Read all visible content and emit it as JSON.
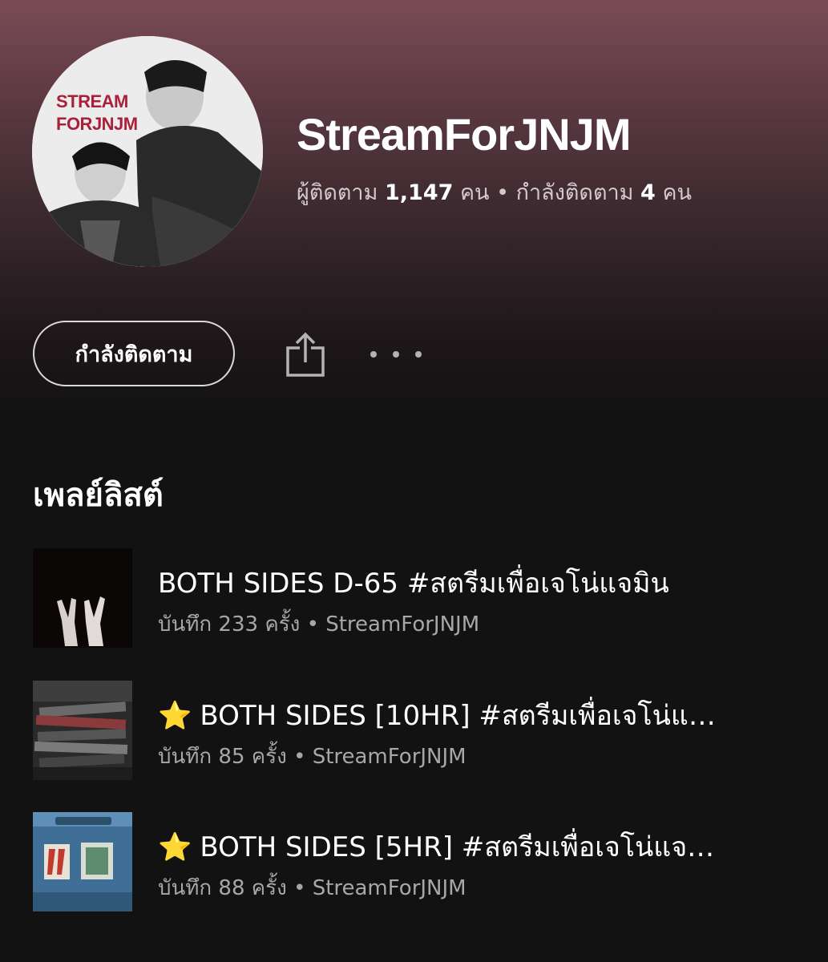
{
  "profile": {
    "avatar_text_line1": "STREAM",
    "avatar_text_line2": "FORJNJM",
    "name": "StreamForJNJM",
    "followers_label": "ผู้ติดตาม",
    "followers_count": "1,147",
    "followers_unit": "คน",
    "separator": "•",
    "following_label": "กำลังติดตาม",
    "following_count": "4",
    "following_unit": "คน"
  },
  "actions": {
    "follow_label": "กำลังติดตาม",
    "share_icon": "share-icon",
    "more_icon": "more-options-icon"
  },
  "playlists_section": {
    "title": "เพลย์ลิสต์",
    "items": [
      {
        "star": "",
        "title": "BOTH SIDES D-65 #สตรีมเพื่อเจโน่แจมิน",
        "meta": "บันทึก 233 ครั้ง • StreamForJNJM"
      },
      {
        "star": "⭐",
        "title": "BOTH SIDES [10HR] #สตรีมเพื่อเจโน่แ…",
        "meta": "บันทึก 85 ครั้ง • StreamForJNJM"
      },
      {
        "star": "⭐",
        "title": "BOTH SIDES [5HR] #สตรีมเพื่อเจโน่แจ…",
        "meta": "บันทึก 88 ครั้ง • StreamForJNJM"
      }
    ]
  },
  "colors": {
    "header_gradient_top": "#7a4b55",
    "background": "#121212",
    "secondary_text": "#a7a7a7",
    "star": "#f5c518"
  }
}
